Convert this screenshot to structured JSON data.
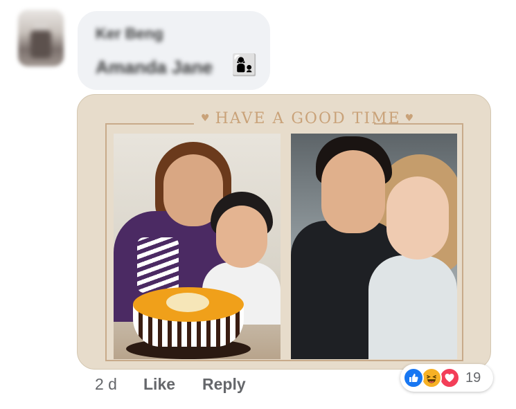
{
  "comment": {
    "author_name": "Ker Beng",
    "message": "Amanda Jane",
    "emoji": "👩‍👦"
  },
  "attachment": {
    "title": "HAVE A GOOD TIME"
  },
  "actions": {
    "timestamp": "2 d",
    "like_label": "Like",
    "reply_label": "Reply"
  },
  "reactions": {
    "icons": [
      "like-icon",
      "haha-icon",
      "love-icon"
    ],
    "count": "19"
  },
  "colors": {
    "bubble_bg": "#f0f2f5",
    "card_bg": "#e7dccb",
    "card_accent": "#c9a279",
    "like_blue": "#1877f2",
    "haha_yellow": "#f7b125",
    "love_red": "#f33e58",
    "secondary_text": "#65676b"
  }
}
